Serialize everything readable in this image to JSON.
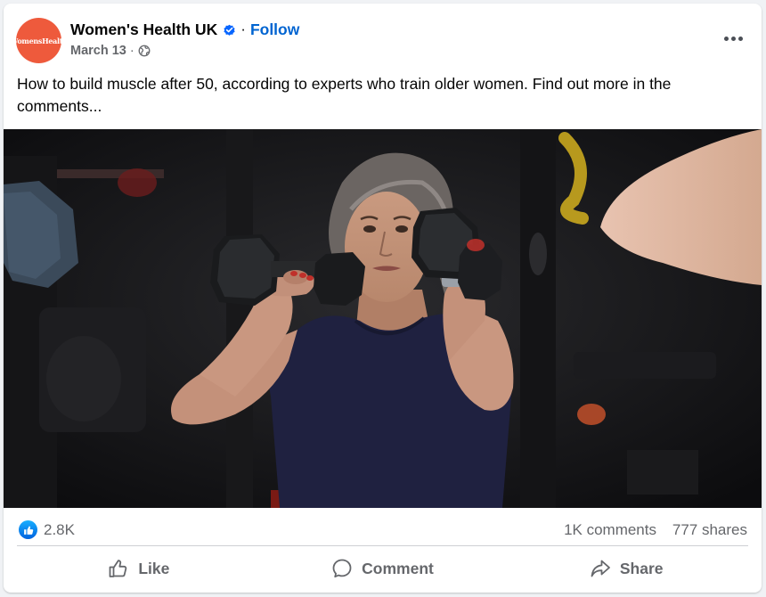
{
  "post": {
    "page_name": "Women's Health UK",
    "separator": "·",
    "follow_label": "Follow",
    "date": "March 13",
    "meta_separator": "·",
    "privacy_icon": "globe-icon",
    "avatar_text": "WomensHealth",
    "caption": "How to build muscle after 50, according to experts who train older women. Find out more in the comments...",
    "more_icon": "more-options-icon"
  },
  "stats": {
    "reaction_icon": "like-reaction-icon",
    "reactions": "2.8K",
    "comments": "1K comments",
    "shares": "777 shares"
  },
  "actions": [
    {
      "label": "Like",
      "icon": "thumbs-up-icon"
    },
    {
      "label": "Comment",
      "icon": "comment-bubble-icon"
    },
    {
      "label": "Share",
      "icon": "share-arrow-icon"
    }
  ],
  "colors": {
    "brand_avatar": "#ee5a3c",
    "follow_link": "#0064d1",
    "secondary_text": "#65676b",
    "like_blue": "#0866ff"
  }
}
